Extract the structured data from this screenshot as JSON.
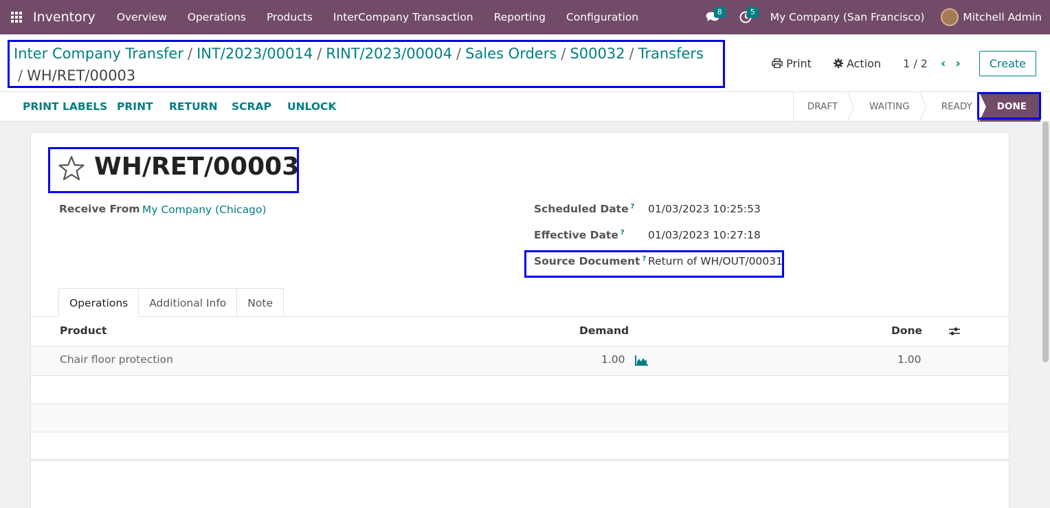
{
  "navbar": {
    "brand": "Inventory",
    "menu": [
      "Overview",
      "Operations",
      "Products",
      "InterCompany Transaction",
      "Reporting",
      "Configuration"
    ],
    "messages_count": "8",
    "activities_count": "5",
    "company": "My Company (San Francisco)",
    "user": "Mitchell Admin"
  },
  "breadcrumb": {
    "items": [
      "Inter Company Transfer",
      "INT/2023/00014",
      "RINT/2023/00004",
      "Sales Orders",
      "S00032",
      "Transfers"
    ],
    "current": "WH/RET/00003"
  },
  "control": {
    "print_label": "Print",
    "action_label": "Action",
    "pager": "1 / 2",
    "create_label": "Create"
  },
  "actions": [
    "PRINT LABELS",
    "PRINT",
    "RETURN",
    "SCRAP",
    "UNLOCK"
  ],
  "stages": [
    "DRAFT",
    "WAITING",
    "READY",
    "DONE"
  ],
  "record": {
    "title": "WH/RET/00003",
    "receive_from_label": "Receive From",
    "receive_from_value": "My Company (Chicago)",
    "scheduled_date_label": "Scheduled Date",
    "scheduled_date_value": "01/03/2023 10:25:53",
    "effective_date_label": "Effective Date",
    "effective_date_value": "01/03/2023 10:27:18",
    "source_document_label": "Source Document",
    "source_document_value": "Return of WH/OUT/00031",
    "help_mark": "?"
  },
  "tabs": [
    "Operations",
    "Additional Info",
    "Note"
  ],
  "table": {
    "headers": {
      "product": "Product",
      "demand": "Demand",
      "done": "Done"
    },
    "rows": [
      {
        "product": "Chair floor protection",
        "demand": "1.00",
        "done": "1.00"
      }
    ]
  }
}
